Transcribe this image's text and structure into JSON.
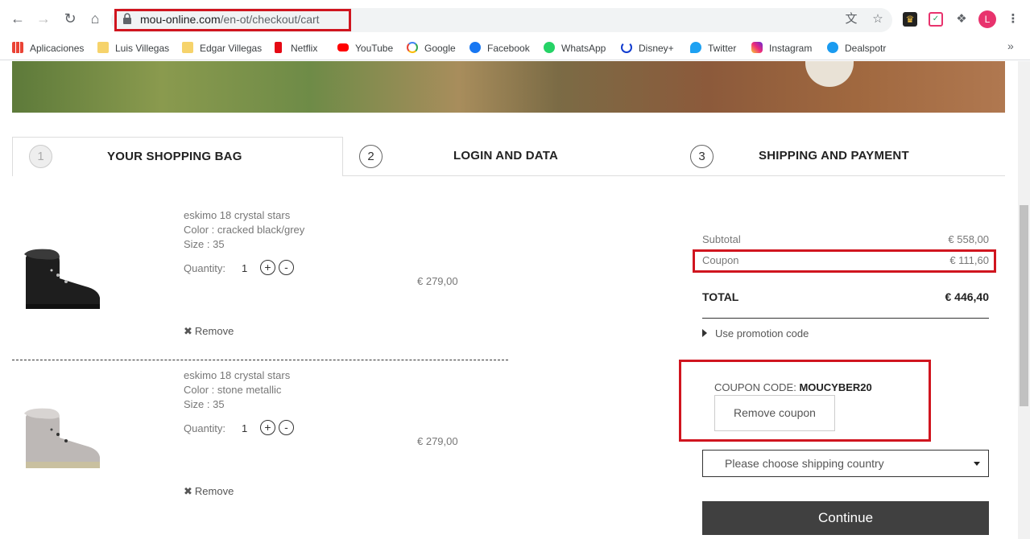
{
  "browser": {
    "url_domain": "mou-online.com",
    "url_path": "/en-ot/checkout/cart",
    "profile_initial": "L",
    "bookmarks": [
      {
        "label": "Aplicaciones",
        "icon": "apps-grid-icon",
        "color": "#4285f4"
      },
      {
        "label": "Luis Villegas",
        "icon": "folder-icon",
        "color": "#f6d36b"
      },
      {
        "label": "Edgar Villegas",
        "icon": "folder-icon",
        "color": "#f6d36b"
      },
      {
        "label": "Netflix",
        "icon": "netflix-icon",
        "color": "#e50914"
      },
      {
        "label": "YouTube",
        "icon": "youtube-icon",
        "color": "#ff0000"
      },
      {
        "label": "Google",
        "icon": "google-icon",
        "color": "#4285f4"
      },
      {
        "label": "Facebook",
        "icon": "facebook-icon",
        "color": "#1877f2"
      },
      {
        "label": "WhatsApp",
        "icon": "whatsapp-icon",
        "color": "#25d366"
      },
      {
        "label": "Disney+",
        "icon": "disney-icon",
        "color": "#113ccf"
      },
      {
        "label": "Twitter",
        "icon": "twitter-icon",
        "color": "#1da1f2"
      },
      {
        "label": "Instagram",
        "icon": "instagram-icon",
        "color": "#c13584"
      },
      {
        "label": "Dealspotr",
        "icon": "dealspotr-icon",
        "color": "#1a9bf0"
      }
    ]
  },
  "steps": [
    {
      "number": "1",
      "label": "YOUR SHOPPING BAG"
    },
    {
      "number": "2",
      "label": "LOGIN AND DATA"
    },
    {
      "number": "3",
      "label": "SHIPPING AND PAYMENT"
    }
  ],
  "items": [
    {
      "name": "eskimo 18 crystal stars",
      "color": "Color : cracked black/grey",
      "size": "Size : 35",
      "quantity_label": "Quantity:",
      "quantity": "1",
      "price": "€ 279,00",
      "remove": "Remove"
    },
    {
      "name": "eskimo 18 crystal stars",
      "color": "Color : stone metallic",
      "size": "Size : 35",
      "quantity_label": "Quantity:",
      "quantity": "1",
      "price": "€ 279,00",
      "remove": "Remove"
    }
  ],
  "summary": {
    "subtotal_label": "Subtotal",
    "subtotal": "€ 558,00",
    "coupon_label": "Coupon",
    "coupon": "€ 111,60",
    "total_label": "TOTAL",
    "total": "€ 446,40",
    "promo_label": "Use promotion code",
    "coupon_code_label": "COUPON CODE:",
    "coupon_code": "MOUCYBER20",
    "remove_coupon": "Remove coupon",
    "country_placeholder": "Please choose shipping country",
    "continue": "Continue"
  }
}
